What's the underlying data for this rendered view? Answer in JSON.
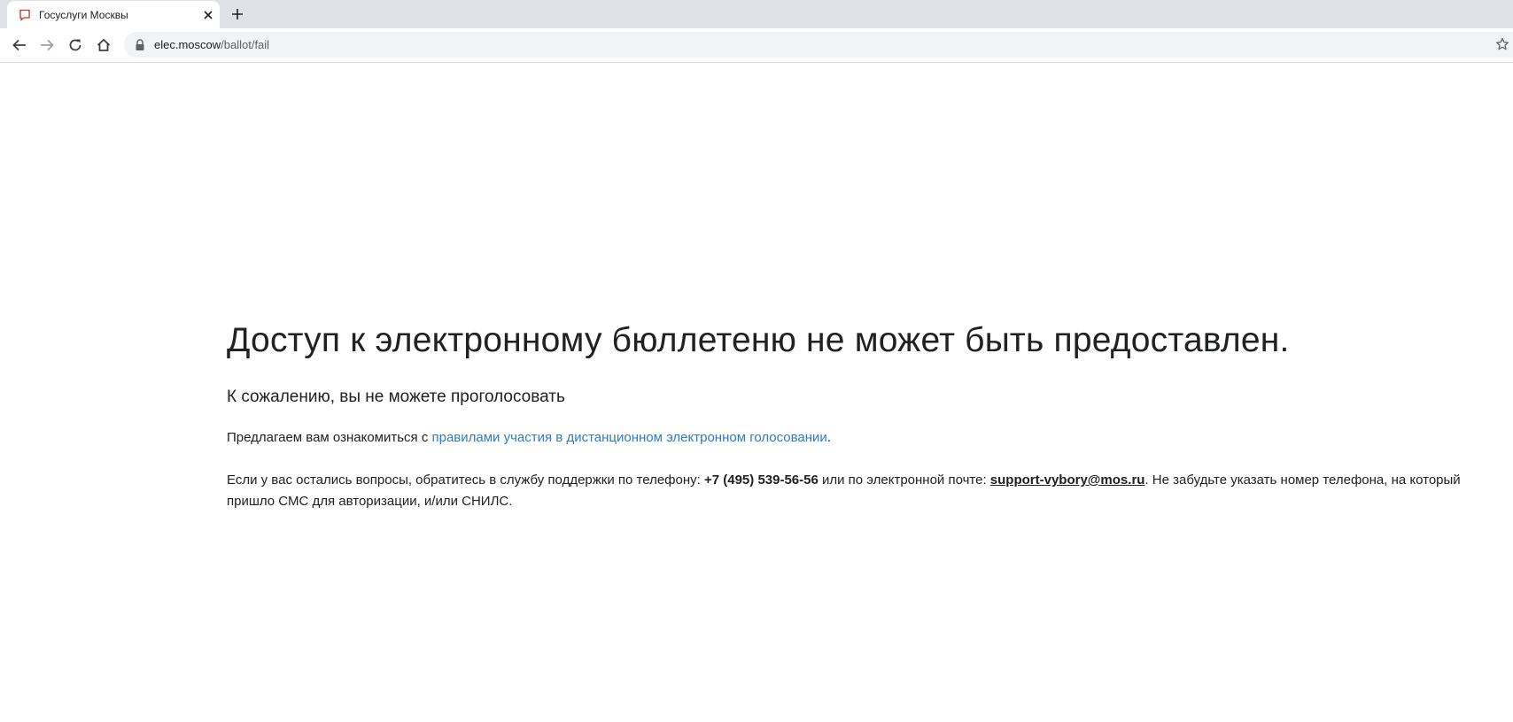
{
  "browser": {
    "tab": {
      "title": "Госуслуги Москвы"
    },
    "address_bar": {
      "host": "elec.moscow",
      "path": "/ballot/fail"
    }
  },
  "page": {
    "title": "Доступ к электронному бюллетеню не может быть предоставлен.",
    "subtitle": "К сожалению, вы не можете проголосовать",
    "rules_paragraph": {
      "prefix": "Предлагаем вам ознакомиться с ",
      "link_text": "правилами участия в дистанционном электронном голосовании",
      "suffix": "."
    },
    "support_paragraph": {
      "prefix": "Если у вас остались вопросы, обратитесь в службу поддержки по телефону: ",
      "phone": "+7 (495) 539-56-56",
      "middle": " или по электронной почте: ",
      "email": "support-vybory@mos.ru",
      "suffix": ". Не забудьте указать номер телефона, на который пришло СМС для авторизации, и/или СНИЛС."
    }
  },
  "colors": {
    "link": "#2f7bc6",
    "favicon": "#c0392b",
    "tabstrip": "#dee1e6"
  }
}
